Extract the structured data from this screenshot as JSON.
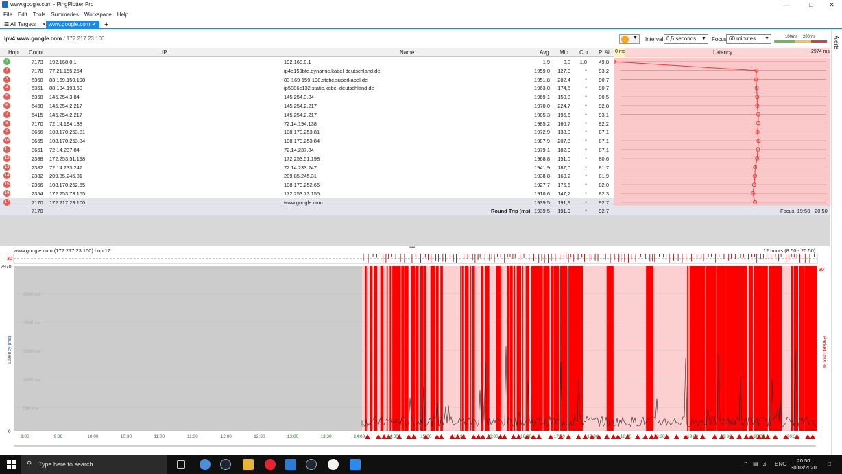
{
  "window": {
    "title": "www.google.com - PingPlotter Pro"
  },
  "menu": [
    "File",
    "Edit",
    "Tools",
    "Summaries",
    "Workspace",
    "Help"
  ],
  "tabs": {
    "all_targets": "All Targets",
    "active": "www.google.com"
  },
  "target": {
    "label": "ipv4:www.google.com",
    "ip": "/ 172.217.23.100"
  },
  "controls": {
    "interval_label": "Interval",
    "interval_value": "0,5 seconds",
    "focus_label": "Focus",
    "focus_value": "60 minutes",
    "scale_100": "100ms",
    "scale_200": "200ms"
  },
  "sidebar": {
    "alerts": "Alerts"
  },
  "table": {
    "headers": {
      "hop": "Hop",
      "count": "Count",
      "ip": "IP",
      "name": "Name",
      "avg": "Avg",
      "min": "Min",
      "cur": "Cur",
      "pl": "PL%",
      "lat_min": "0 ms",
      "latency": "Latency",
      "lat_max": "2974 ms"
    },
    "rows": [
      {
        "hop": "1",
        "count": "7173",
        "ip": "192.168.0.1",
        "name": "192.168.0.1",
        "avg": "1,9",
        "min": "0,0",
        "cur": "1,0",
        "pl": "49,8"
      },
      {
        "hop": "2",
        "count": "7170",
        "ip": "77.21.155.254",
        "name": "ip4d159bfe.dynamic.kabel-deutschland.de",
        "avg": "1959,0",
        "min": "127,0",
        "cur": "*",
        "pl": "93,2"
      },
      {
        "hop": "3",
        "count": "5360",
        "ip": "83.169.159.198",
        "name": "83-169-159-198.static.superkabel.de",
        "avg": "1951,8",
        "min": "202,4",
        "cur": "*",
        "pl": "90,7"
      },
      {
        "hop": "4",
        "count": "5361",
        "ip": "88.134.193.50",
        "name": "ip5886c132.static.kabel-deutschland.de",
        "avg": "1963,0",
        "min": "174,5",
        "cur": "*",
        "pl": "90,7"
      },
      {
        "hop": "5",
        "count": "5358",
        "ip": "145.254.3.84",
        "name": "145.254.3.84",
        "avg": "1969,1",
        "min": "150,8",
        "cur": "*",
        "pl": "90,5"
      },
      {
        "hop": "6",
        "count": "5468",
        "ip": "145.254.2.217",
        "name": "145.254.2.217",
        "avg": "1970,0",
        "min": "224,7",
        "cur": "*",
        "pl": "92,8"
      },
      {
        "hop": "7",
        "count": "5415",
        "ip": "145.254.2.217",
        "name": "145.254.2.217",
        "avg": "1985,3",
        "min": "195,6",
        "cur": "*",
        "pl": "93,1"
      },
      {
        "hop": "8",
        "count": "7170",
        "ip": "72.14.194.138",
        "name": "72.14.194.138",
        "avg": "1985,2",
        "min": "166,7",
        "cur": "*",
        "pl": "92,2"
      },
      {
        "hop": "9",
        "count": "3666",
        "ip": "108.170.253.81",
        "name": "108.170.253.81",
        "avg": "1972,9",
        "min": "138,0",
        "cur": "*",
        "pl": "87,1"
      },
      {
        "hop": "10",
        "count": "3665",
        "ip": "108.170.253.84",
        "name": "108.170.253.84",
        "avg": "1987,9",
        "min": "207,3",
        "cur": "*",
        "pl": "87,1"
      },
      {
        "hop": "11",
        "count": "3651",
        "ip": "72.14.237.84",
        "name": "72.14.237.84",
        "avg": "1979,1",
        "min": "182,0",
        "cur": "*",
        "pl": "87,1"
      },
      {
        "hop": "12",
        "count": "2388",
        "ip": "172.253.51.198",
        "name": "172.253.51.198",
        "avg": "1968,8",
        "min": "151,0",
        "cur": "*",
        "pl": "80,6"
      },
      {
        "hop": "13",
        "count": "2382",
        "ip": "72.14.233.247",
        "name": "72.14.233.247",
        "avg": "1941,9",
        "min": "187,0",
        "cur": "*",
        "pl": "81,7"
      },
      {
        "hop": "14",
        "count": "2382",
        "ip": "209.85.245.31",
        "name": "209.85.245.31",
        "avg": "1938,8",
        "min": "160,2",
        "cur": "*",
        "pl": "81,9"
      },
      {
        "hop": "15",
        "count": "2366",
        "ip": "108.170.252.65",
        "name": "108.170.252.65",
        "avg": "1927,7",
        "min": "175,6",
        "cur": "*",
        "pl": "82,0"
      },
      {
        "hop": "16",
        "count": "2354",
        "ip": "172.253.73.155",
        "name": "172.253.73.155",
        "avg": "1910,6",
        "min": "147,7",
        "cur": "*",
        "pl": "82,3"
      },
      {
        "hop": "17",
        "count": "7170",
        "ip": "172.217.23.100",
        "name": "www.google.com",
        "avg": "1939,5",
        "min": "191,9",
        "cur": "*",
        "pl": "92,7"
      }
    ],
    "summary": {
      "count": "7170",
      "label": "Round Trip (ms)",
      "avg": "1939,5",
      "min": "191,9",
      "cur": "*",
      "pl": "92,7",
      "focus": "Focus: 19:50 - 20:50"
    }
  },
  "graph": {
    "title": "www.google.com (172.217.23.100) hop 17",
    "range": "12 hours (8:50 - 20:50)",
    "loss_max": "30",
    "lat_max": "2970",
    "y_ticks": [
      "2500 ms",
      "2000 ms",
      "1500 ms",
      "1000 ms",
      "500 ms",
      "0"
    ],
    "y_label": "Latency (ms)",
    "y2_label": "Packet Loss %",
    "loss_right": "30",
    "x_ticks": [
      "9:00",
      "9:30",
      "10:00",
      "10:30",
      "11:00",
      "11:30",
      "12:00",
      "12:30",
      "13:00",
      "13:30",
      "14:00",
      "14:30",
      "15:00",
      "15:30",
      "16:00",
      "16:30",
      "17:00",
      "17:30",
      "18:00",
      "18:30",
      "19:00",
      "19:30",
      "20:00",
      "20:30"
    ]
  },
  "taskbar": {
    "search_placeholder": "Type here to search",
    "lang": "ENG",
    "time": "20:50",
    "date": "30/03/2020"
  },
  "colors": {
    "accent": "#1e88e5",
    "loss_red": "#ff0000",
    "light_red": "#fac8c8",
    "gray": "#cccccc"
  }
}
